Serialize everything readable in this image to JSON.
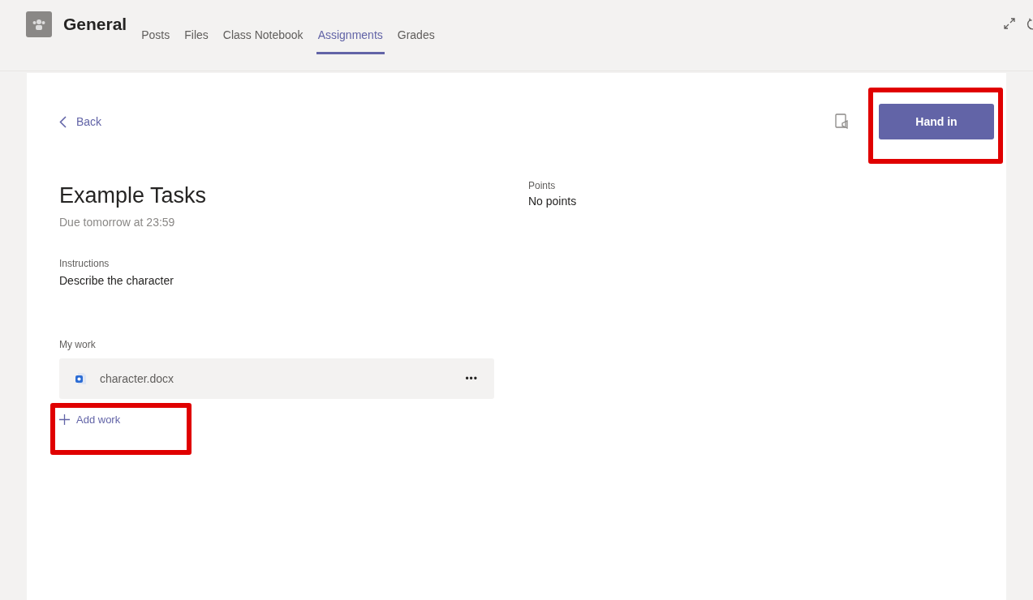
{
  "header": {
    "channel": "General",
    "tabs": [
      {
        "label": "Posts",
        "selected": false
      },
      {
        "label": "Files",
        "selected": false
      },
      {
        "label": "Class Notebook",
        "selected": false
      },
      {
        "label": "Assignments",
        "selected": true
      },
      {
        "label": "Grades",
        "selected": false
      }
    ]
  },
  "assignment": {
    "back": "Back",
    "hand_in": "Hand in",
    "title": "Example Tasks",
    "due": "Due tomorrow at 23:59",
    "instructions_label": "Instructions",
    "instructions": "Describe the character",
    "points_label": "Points",
    "points": "No points",
    "my_work_label": "My work",
    "files": [
      {
        "name": "character.docx",
        "more": "•••"
      }
    ],
    "add_work": "Add work"
  }
}
